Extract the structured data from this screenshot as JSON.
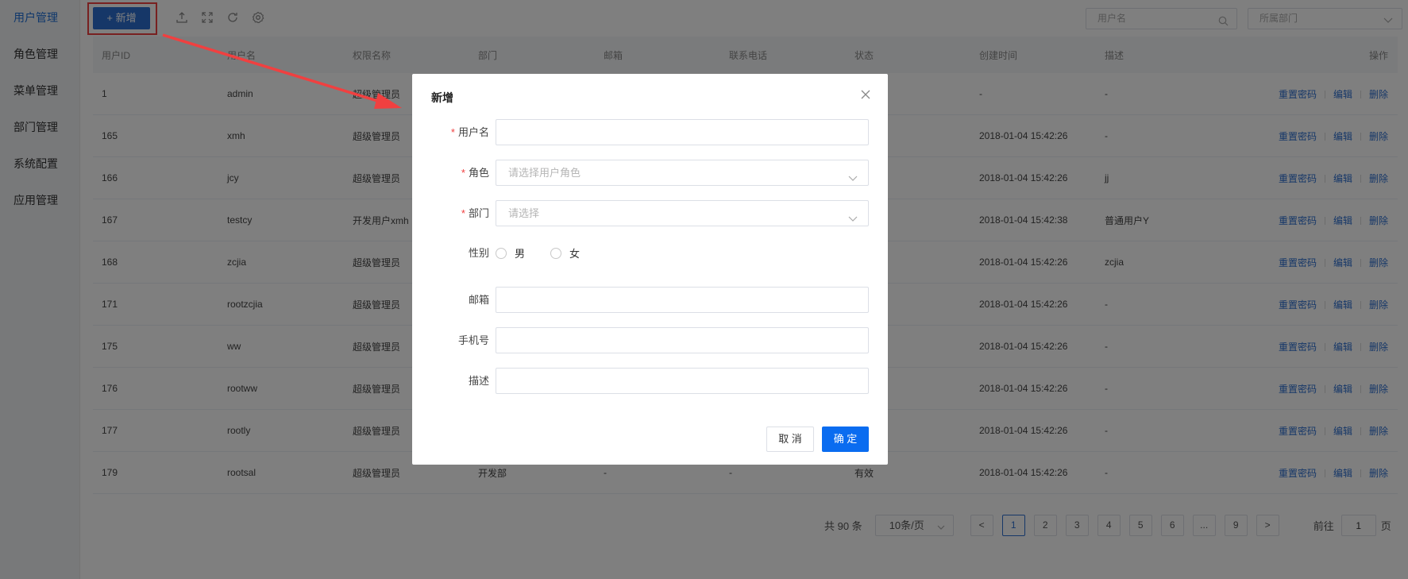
{
  "sidebar": {
    "items": [
      {
        "label": "用户管理",
        "active": true
      },
      {
        "label": "角色管理"
      },
      {
        "label": "菜单管理"
      },
      {
        "label": "部门管理"
      },
      {
        "label": "系统配置"
      },
      {
        "label": "应用管理"
      }
    ]
  },
  "toolbar": {
    "add_label": "+ 新增",
    "icons": [
      "import-icon",
      "fullscreen-icon",
      "refresh-icon",
      "settings-icon"
    ],
    "search_placeholder": "用户名",
    "dept_placeholder": "所属部门"
  },
  "table": {
    "headers": [
      "用户ID",
      "用户名",
      "权限名称",
      "部门",
      "邮箱",
      "联系电话",
      "状态",
      "创建时间",
      "描述",
      "操作"
    ],
    "rows": [
      {
        "id": "1",
        "name": "admin",
        "role": "超级管理员",
        "dept": "",
        "email": "",
        "phone": "",
        "status": "",
        "created": "-",
        "desc": "-"
      },
      {
        "id": "165",
        "name": "xmh",
        "role": "超级管理员",
        "dept": "",
        "email": "",
        "phone": "",
        "status": "",
        "created": "2018-01-04 15:42:26",
        "desc": "-"
      },
      {
        "id": "166",
        "name": "jcy",
        "role": "超级管理员",
        "dept": "",
        "email": "",
        "phone": "",
        "status": "",
        "created": "2018-01-04 15:42:26",
        "desc": "jj"
      },
      {
        "id": "167",
        "name": "testcy",
        "role": "开发用户xmh",
        "dept": "",
        "email": "",
        "phone": "",
        "status": "",
        "created": "2018-01-04 15:42:38",
        "desc": "普通用户Y"
      },
      {
        "id": "168",
        "name": "zcjia",
        "role": "超级管理员",
        "dept": "",
        "email": "",
        "phone": "",
        "status": "",
        "created": "2018-01-04 15:42:26",
        "desc": "zcjia"
      },
      {
        "id": "171",
        "name": "rootzcjia",
        "role": "超级管理员",
        "dept": "",
        "email": "",
        "phone": "",
        "status": "",
        "created": "2018-01-04 15:42:26",
        "desc": "-"
      },
      {
        "id": "175",
        "name": "ww",
        "role": "超级管理员",
        "dept": "",
        "email": "",
        "phone": "",
        "status": "",
        "created": "2018-01-04 15:42:26",
        "desc": "-"
      },
      {
        "id": "176",
        "name": "rootww",
        "role": "超级管理员",
        "dept": "",
        "email": "",
        "phone": "",
        "status": "",
        "created": "2018-01-04 15:42:26",
        "desc": "-"
      },
      {
        "id": "177",
        "name": "rootly",
        "role": "超级管理员",
        "dept": "",
        "email": "",
        "phone": "",
        "status": "",
        "created": "2018-01-04 15:42:26",
        "desc": "-"
      },
      {
        "id": "179",
        "name": "rootsal",
        "role": "超级管理员",
        "dept": "开发部",
        "email": "-",
        "phone": "-",
        "status": "有效",
        "created": "2018-01-04 15:42:26",
        "desc": "-"
      }
    ],
    "ops": {
      "reset": "重置密码",
      "edit": "编辑",
      "delete": "删除"
    }
  },
  "pager": {
    "total": "共 90 条",
    "size": "10条/页",
    "prev": "<",
    "pages": [
      "1",
      "2",
      "3",
      "4",
      "5",
      "6",
      "...",
      "9"
    ],
    "active_page": "1",
    "next": ">",
    "goto_label": "前往",
    "goto_value": "1",
    "page_unit": "页"
  },
  "modal": {
    "title": "新增",
    "fields": {
      "username_label": "用户名",
      "role_label": "角色",
      "role_placeholder": "请选择用户角色",
      "dept_label": "部门",
      "dept_placeholder": "请选择",
      "gender_label": "性别",
      "gender_male": "男",
      "gender_female": "女",
      "email_label": "邮箱",
      "phone_label": "手机号",
      "desc_label": "描述"
    },
    "cancel": "取 消",
    "ok": "确 定"
  },
  "colors": {
    "primary": "#2d6fd1",
    "ok_button": "#0a6cf0",
    "annotation": "#f04040"
  }
}
